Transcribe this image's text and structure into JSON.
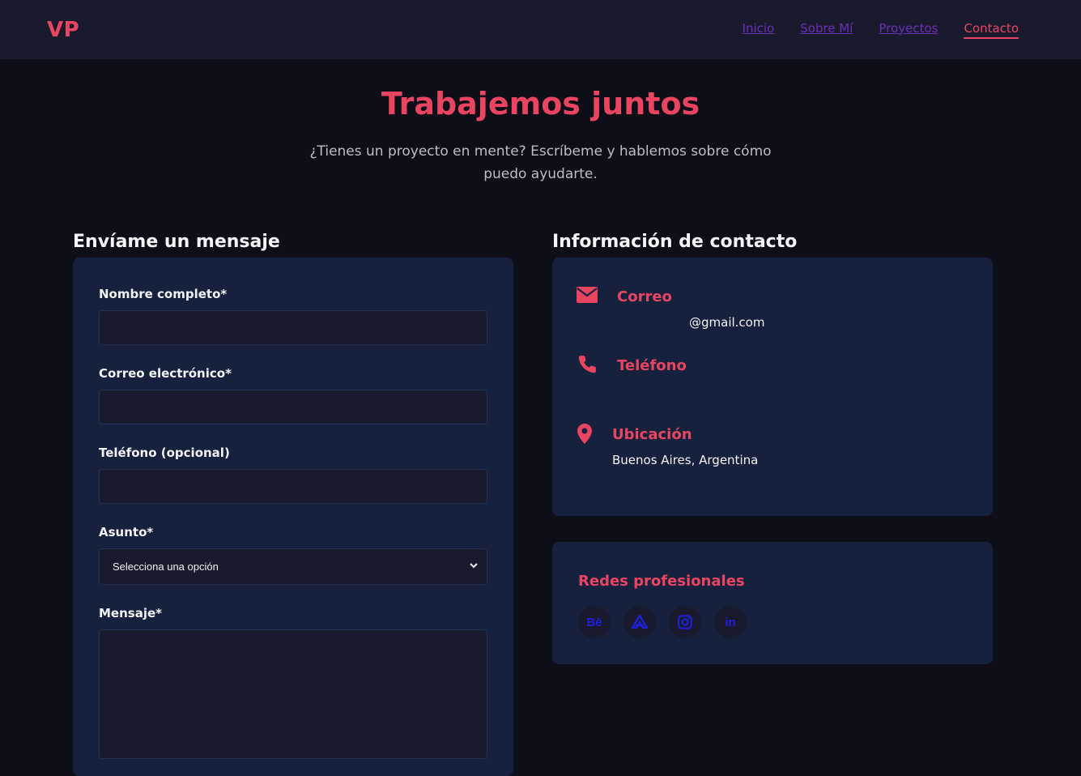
{
  "nav": {
    "logo": "VP",
    "links": [
      "Inicio",
      "Sobre Mí",
      "Proyectos",
      "Contacto"
    ],
    "active": "Contacto"
  },
  "hero": {
    "title": "Trabajemos juntos",
    "subtitle": "¿Tienes un proyecto en mente? Escríbeme y hablemos sobre cómo puedo ayudarte."
  },
  "form": {
    "heading": "Envíame un mensaje",
    "name_label": "Nombre completo*",
    "email_label": "Correo electrónico*",
    "phone_label": "Teléfono (opcional)",
    "subject_label": "Asunto*",
    "subject_selected": "Selecciona una opción",
    "message_label": "Mensaje*"
  },
  "contact": {
    "heading": "Información de contacto",
    "email_title": "Correo",
    "email_value": "@gmail.com",
    "phone_title": "Teléfono",
    "location_title": "Ubicación",
    "location_value": "Buenos Aires, Argentina"
  },
  "social": {
    "heading": "Redes profesionales",
    "icons": [
      "behance-icon",
      "artstation-icon",
      "instagram-icon",
      "linkedin-icon"
    ],
    "behance_glyph": "Bē",
    "linkedin_glyph": "in"
  },
  "colors": {
    "accent": "#e94560",
    "navbar_bg": "#1a1a2e",
    "page_bg": "#0e0e18",
    "card_bg": "#16213e",
    "nav_link": "#6b2fb5",
    "social_icon": "#1f1fe0"
  }
}
